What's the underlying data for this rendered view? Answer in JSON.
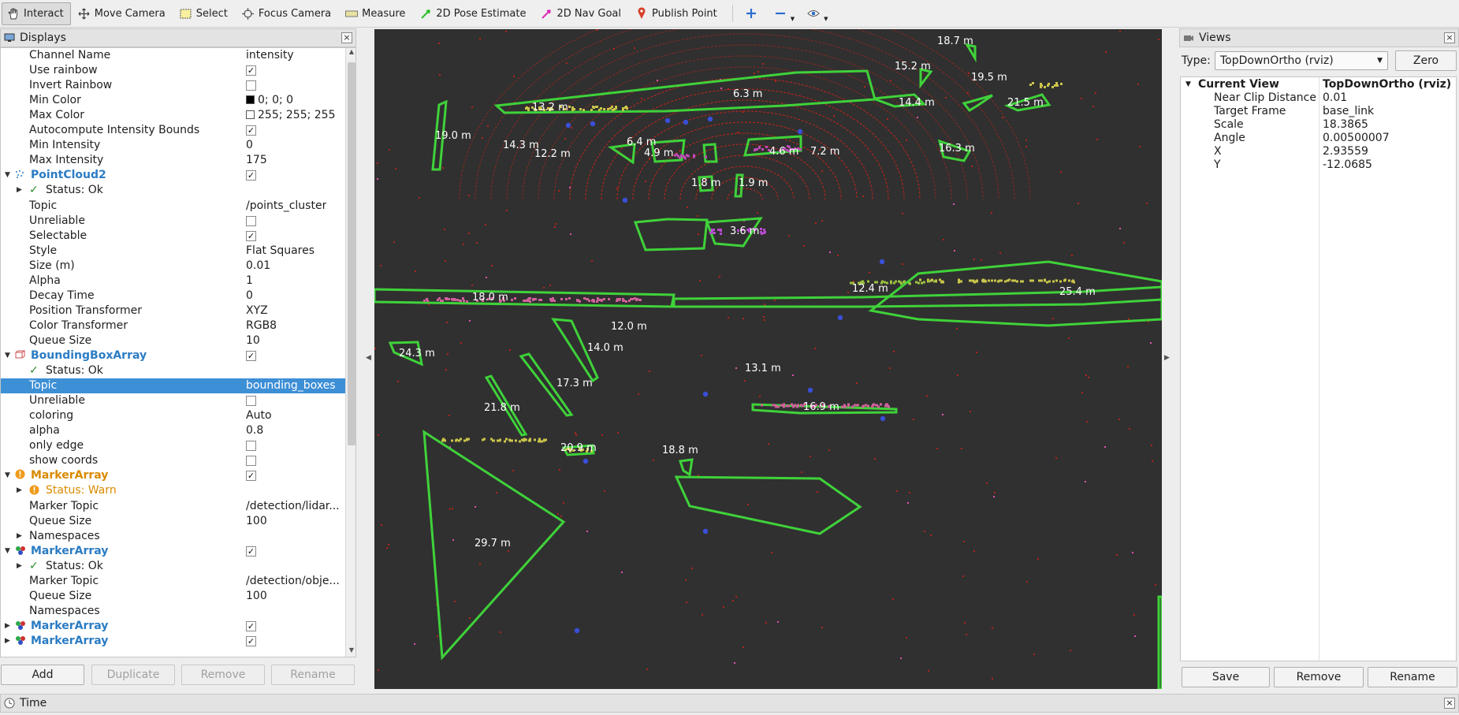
{
  "toolbar": {
    "tools": [
      {
        "label": "Interact",
        "icon": "hand-icon",
        "active": true
      },
      {
        "label": "Move Camera",
        "icon": "move-camera-icon"
      },
      {
        "label": "Select",
        "icon": "select-box-icon"
      },
      {
        "label": "Focus Camera",
        "icon": "focus-camera-icon"
      },
      {
        "label": "Measure",
        "icon": "ruler-icon"
      },
      {
        "label": "2D Pose Estimate",
        "icon": "green-arrow-icon"
      },
      {
        "label": "2D Nav Goal",
        "icon": "pink-arrow-icon"
      },
      {
        "label": "Publish Point",
        "icon": "map-pin-icon"
      }
    ],
    "add_tool_icon": "plus-icon",
    "remove_tool_icon": "minus-icon",
    "camera_type_icon": "eye-icon"
  },
  "displays": {
    "title": "Displays",
    "close": "×",
    "rows": [
      {
        "name": "Channel Name",
        "value": "intensity",
        "indent": 1
      },
      {
        "name": "Use rainbow",
        "check": true,
        "indent": 1
      },
      {
        "name": "Invert Rainbow",
        "check": false,
        "indent": 1
      },
      {
        "name": "Min Color",
        "value": "0; 0; 0",
        "swatch": "#000000",
        "indent": 1
      },
      {
        "name": "Max Color",
        "value": "255; 255; 255",
        "swatch": "#ffffff",
        "indent": 1
      },
      {
        "name": "Autocompute Intensity Bounds",
        "check": true,
        "indent": 1
      },
      {
        "name": "Min Intensity",
        "value": "0",
        "indent": 1
      },
      {
        "name": "Max Intensity",
        "value": "175",
        "indent": 1
      },
      {
        "name": "PointCloud2",
        "check": true,
        "group": true,
        "icon": "pointcloud-icon",
        "expanded": true
      },
      {
        "name": "Status: Ok",
        "status": "ok",
        "indent": 1,
        "collapsed": true
      },
      {
        "name": "Topic",
        "value": "/points_cluster",
        "indent": 1
      },
      {
        "name": "Unreliable",
        "check": false,
        "indent": 1
      },
      {
        "name": "Selectable",
        "check": true,
        "indent": 1
      },
      {
        "name": "Style",
        "value": "Flat Squares",
        "indent": 1
      },
      {
        "name": "Size (m)",
        "value": "0.01",
        "indent": 1
      },
      {
        "name": "Alpha",
        "value": "1",
        "indent": 1
      },
      {
        "name": "Decay Time",
        "value": "0",
        "indent": 1
      },
      {
        "name": "Position Transformer",
        "value": "XYZ",
        "indent": 1
      },
      {
        "name": "Color Transformer",
        "value": "RGB8",
        "indent": 1
      },
      {
        "name": "Queue Size",
        "value": "10",
        "indent": 1
      },
      {
        "name": "BoundingBoxArray",
        "check": true,
        "group": true,
        "icon": "bounding-box-icon",
        "expanded": true
      },
      {
        "name": "Status: Ok",
        "status": "ok",
        "indent": 1
      },
      {
        "name": "Topic",
        "value": "bounding_boxes",
        "indent": 1,
        "selected": true
      },
      {
        "name": "Unreliable",
        "check": false,
        "indent": 1
      },
      {
        "name": "coloring",
        "value": "Auto",
        "indent": 1
      },
      {
        "name": "alpha",
        "value": "0.8",
        "indent": 1
      },
      {
        "name": "only edge",
        "check": false,
        "indent": 1
      },
      {
        "name": "show coords",
        "check": false,
        "indent": 1
      },
      {
        "name": "MarkerArray",
        "check": true,
        "group": true,
        "warn": true,
        "icon": "warning-icon",
        "expanded": true
      },
      {
        "name": "Status: Warn",
        "status": "warn",
        "indent": 1,
        "collapsed": true
      },
      {
        "name": "Marker Topic",
        "value": "/detection/lidar...",
        "indent": 1
      },
      {
        "name": "Queue Size",
        "value": "100",
        "indent": 1
      },
      {
        "name": "Namespaces",
        "indent": 1,
        "collapsed": true
      },
      {
        "name": "MarkerArray",
        "check": true,
        "group": true,
        "icon": "marker-array-icon",
        "expanded": true
      },
      {
        "name": "Status: Ok",
        "status": "ok",
        "indent": 1,
        "collapsed": true
      },
      {
        "name": "Marker Topic",
        "value": "/detection/obje...",
        "indent": 1
      },
      {
        "name": "Queue Size",
        "value": "100",
        "indent": 1
      },
      {
        "name": "Namespaces",
        "indent": 1
      },
      {
        "name": "MarkerArray",
        "check": true,
        "group": true,
        "icon": "marker-array-icon",
        "collapsed": true
      },
      {
        "name": "MarkerArray",
        "check": true,
        "group": true,
        "icon": "marker-array-icon",
        "collapsed": true
      }
    ],
    "buttons": {
      "add": "Add",
      "duplicate": "Duplicate",
      "remove": "Remove",
      "rename": "Rename"
    }
  },
  "viewport": {
    "distance_labels": [
      "18.7 m",
      "15.2 m",
      "19.5 m",
      "6.3 m",
      "21.5 m",
      "13.2 m",
      "14.4 m",
      "19.0 m",
      "6.4 m",
      "14.3 m",
      "12.2 m",
      "4.9 m",
      "4.6 m",
      "7.2 m",
      "16.3 m",
      "1.8 m",
      "1.9 m",
      "3.6 m",
      "12.4 m",
      "25.4 m",
      "18.0 m",
      "12.0 m",
      "24.3 m",
      "14.0 m",
      "13.1 m",
      "17.3 m",
      "21.8 m",
      "16.9 m",
      "20.9 m",
      "18.8 m",
      "29.7 m"
    ]
  },
  "views": {
    "title": "Views",
    "close": "×",
    "type_label": "Type:",
    "type_value": "TopDownOrtho (rviz)",
    "zero": "Zero",
    "current_view": {
      "label": "Current View",
      "value": "TopDownOrtho (rviz)"
    },
    "props": [
      {
        "k": "Near Clip Distance",
        "v": "0.01"
      },
      {
        "k": "Target Frame",
        "v": "base_link"
      },
      {
        "k": "Scale",
        "v": "18.3865"
      },
      {
        "k": "Angle",
        "v": "0.00500007"
      },
      {
        "k": "X",
        "v": "2.93559"
      },
      {
        "k": "Y",
        "v": "-12.0685"
      }
    ],
    "buttons": {
      "save": "Save",
      "remove": "Remove",
      "rename": "Rename"
    }
  },
  "time": {
    "title": "Time",
    "close": "×"
  },
  "colors": {
    "selection": "#3d8fd6",
    "group": "#2b7cc4",
    "warn": "#d98a00",
    "box": "#3fd23a",
    "scan": "#d82a1a"
  }
}
